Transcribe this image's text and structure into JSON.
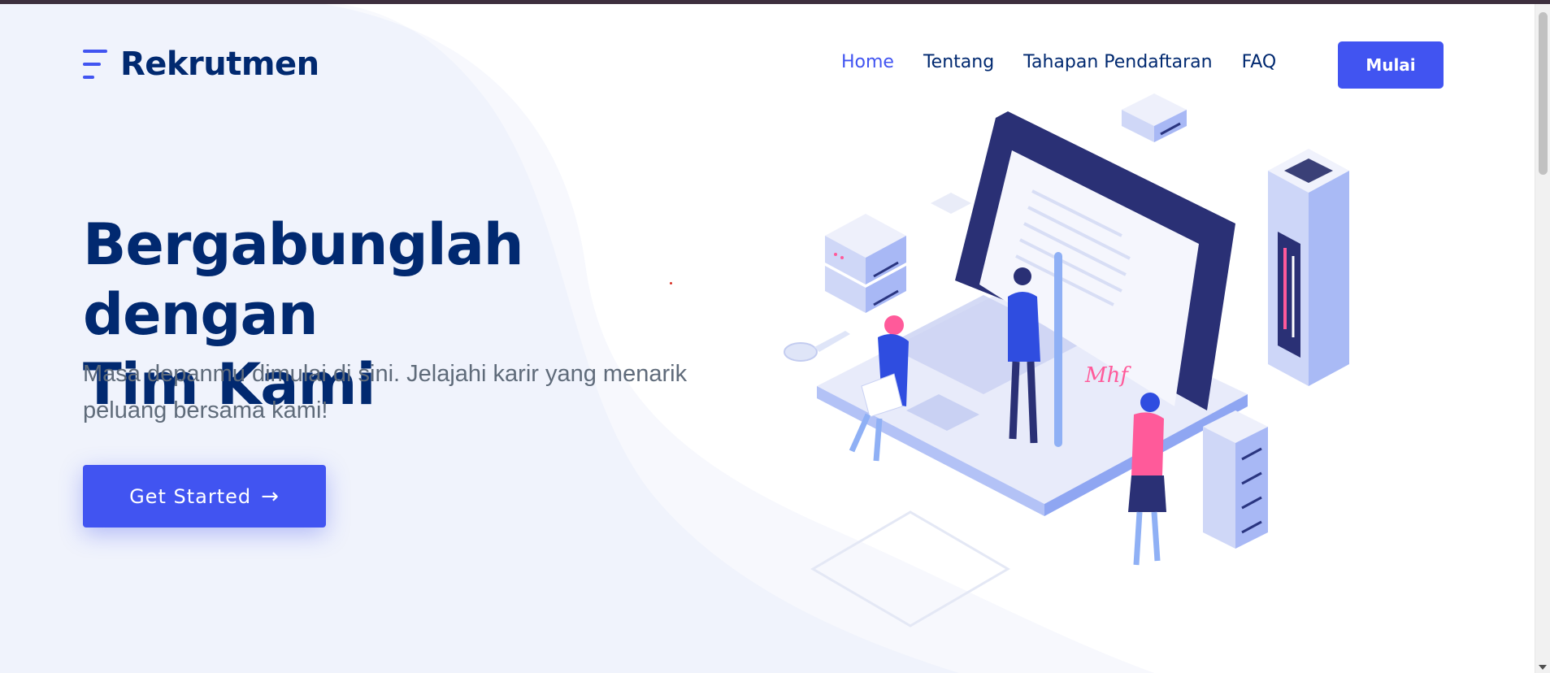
{
  "header": {
    "logo_text": "Rekrutmen",
    "logo_icon": "menu-lines-icon",
    "nav": [
      {
        "label": "Home",
        "active": true
      },
      {
        "label": "Tentang",
        "active": false
      },
      {
        "label": "Tahapan Pendaftaran",
        "active": false
      },
      {
        "label": "FAQ",
        "active": false
      }
    ],
    "cta_label": "Mulai"
  },
  "hero": {
    "title_line1": "Bergabunglah dengan",
    "title_line2": "Tim Kami",
    "subtitle_line1": "Masa depanmu dimulai di sini. Jelajahi karir yang menarik",
    "subtitle_line2": "peluang bersama kami!",
    "button_label": "Get Started",
    "button_icon": "arrow-right-icon"
  },
  "illustration": {
    "name": "isometric-recruitment-illustration",
    "signature_text": "Mhf"
  },
  "colors": {
    "primary": "#4154f1",
    "navy": "#012970",
    "text_muted": "#5f6b7a",
    "pink": "#ff5a9a"
  }
}
